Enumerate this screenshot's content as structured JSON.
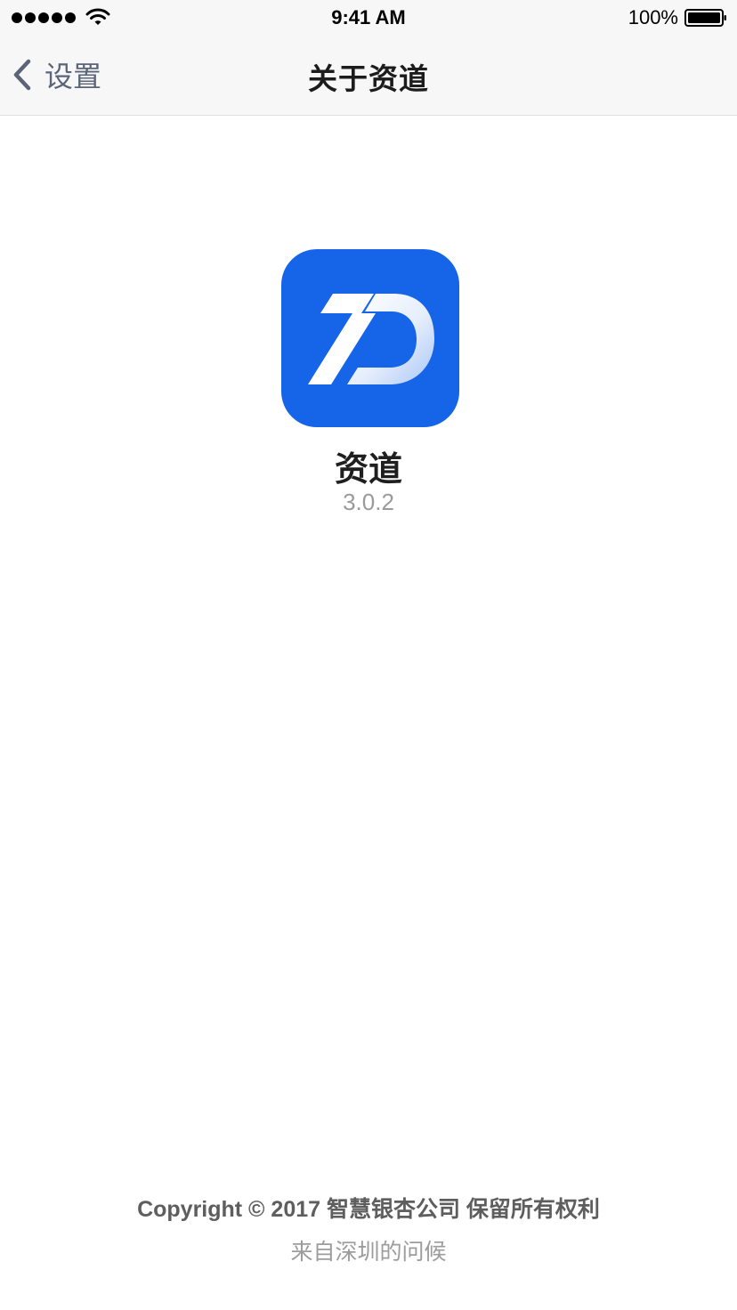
{
  "status_bar": {
    "time": "9:41 AM",
    "battery": "100%",
    "icons": [
      "signal-dots-icon",
      "wifi-icon",
      "battery-icon"
    ]
  },
  "nav": {
    "back_label": "设置",
    "title": "关于资道",
    "icons": [
      "chevron-left-icon"
    ]
  },
  "app": {
    "name": "资道",
    "version": "3.0.2",
    "icon": "app-logo-icon",
    "brand_color": "#1665E8"
  },
  "footer": {
    "copyright": "Copyright © 2017 智慧银杏公司 保留所有权利",
    "greeting": "来自深圳的问候"
  }
}
